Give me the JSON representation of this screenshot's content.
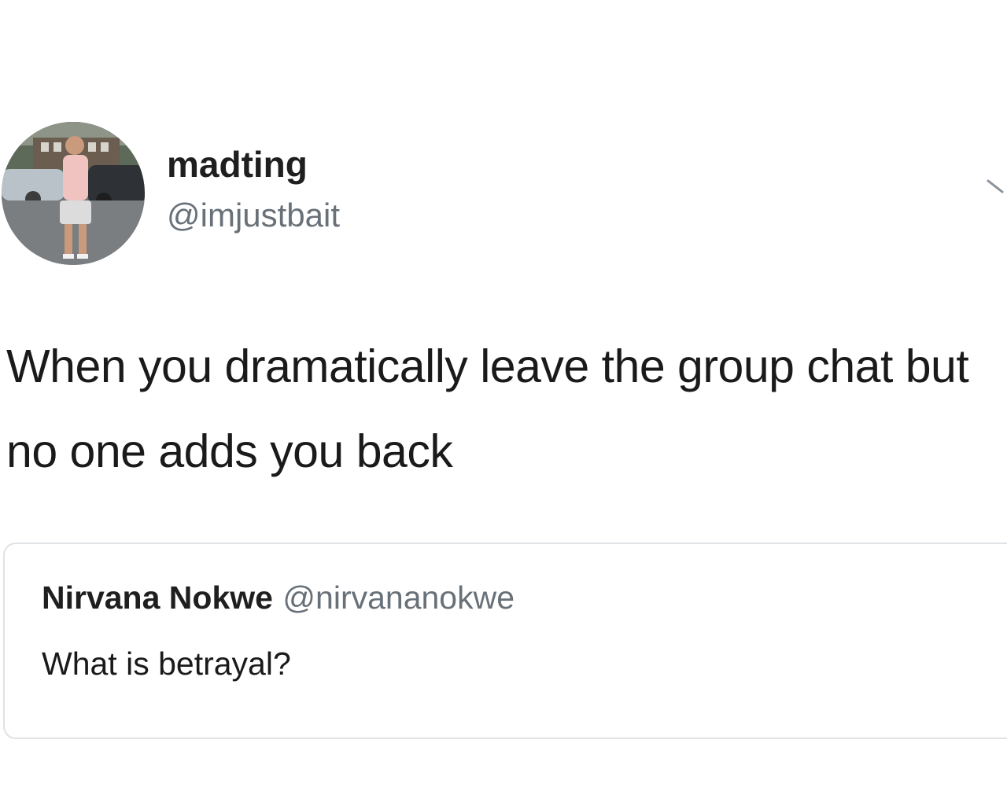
{
  "tweet": {
    "author": {
      "name": "madting",
      "handle": "@imjustbait",
      "avatar_icon": "profile-photo"
    },
    "menu_icon": "chevron-down-icon",
    "text": "When you dramatically leave the group chat but no one adds you back"
  },
  "quoted_tweet": {
    "name": "Nirvana Nokwe",
    "handle": "@nirvananokwe",
    "text": "What is betrayal?"
  },
  "colors": {
    "text": "#1a1a1a",
    "secondary_text": "#687078",
    "card_border": "#dfe3e6",
    "background": "#ffffff"
  }
}
